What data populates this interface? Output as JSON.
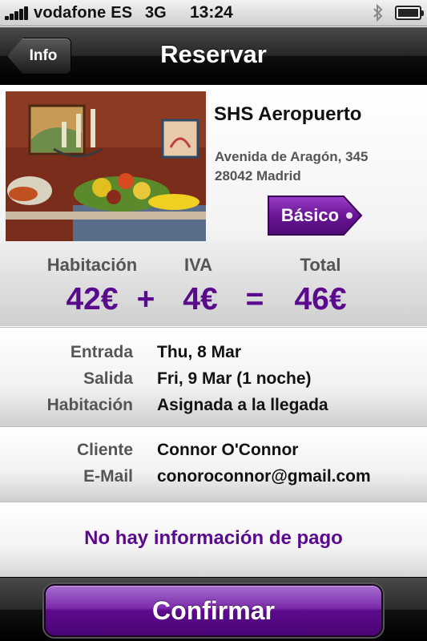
{
  "status_bar": {
    "carrier": "vodafone ES",
    "network": "3G",
    "time": "13:24",
    "icons": [
      "signal-icon",
      "bluetooth-icon",
      "battery-icon"
    ]
  },
  "nav": {
    "back_label": "Info",
    "title": "Reservar"
  },
  "hotel": {
    "name": "SHS Aeropuerto",
    "address_line1": "Avenida de Aragón, 345",
    "address_line2": "28042 Madrid",
    "category_tag": "Básico"
  },
  "price": {
    "room_label": "Habitación",
    "tax_label": "IVA",
    "total_label": "Total",
    "room_value": "42€",
    "plus_sign": "+",
    "tax_value": "4€",
    "equals_sign": "=",
    "total_value": "46€"
  },
  "stay": {
    "checkin_label": "Entrada",
    "checkin_value": "Thu, 8 Mar",
    "checkout_label": "Salida",
    "checkout_value": "Fri, 9 Mar (1 noche)",
    "room_label": "Habitación",
    "room_value": "Asignada a la llegada"
  },
  "client": {
    "name_label": "Cliente",
    "name_value": "Connor O'Connor",
    "email_label": "E-Mail",
    "email_value": "conoroconnor@gmail.com"
  },
  "payment": {
    "message": "No hay información de pago"
  },
  "toolbar": {
    "confirm_label": "Confirmar"
  },
  "colors": {
    "accent_purple": "#5a0a8c",
    "button_purple": "#7b2aaa"
  }
}
